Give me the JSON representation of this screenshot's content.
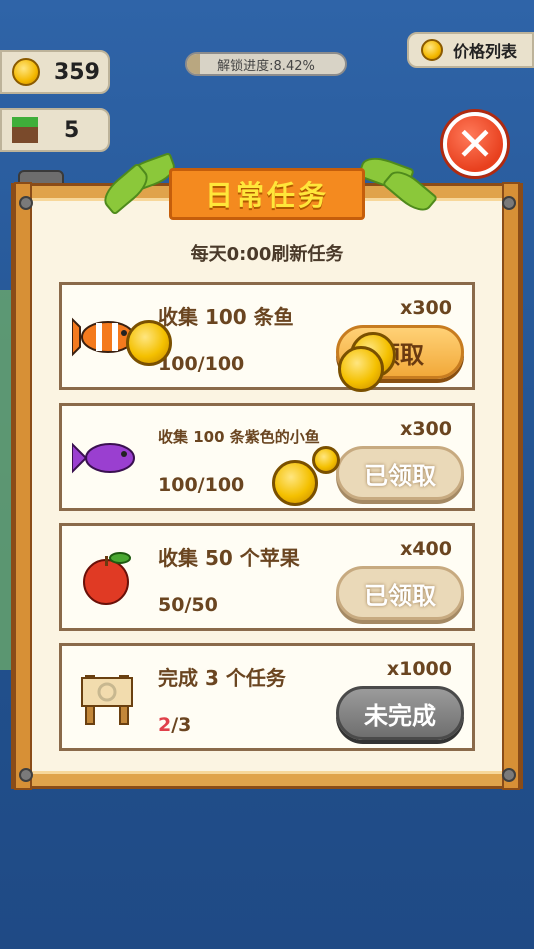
{
  "resources": {
    "coins": "359",
    "blocks": "5"
  },
  "unlock_progress": {
    "label": "解锁进度:8.42%",
    "percent": 8.42
  },
  "price_list": {
    "label": "价格列表"
  },
  "close": {
    "symbol": "✕"
  },
  "panel": {
    "title": "日常任务",
    "subtitle": "每天0:00刷新任务"
  },
  "tasks": [
    {
      "name": "收集 100 条鱼",
      "progress": "100/100",
      "reward": "x300",
      "button": "领取",
      "state": "claim",
      "icon": "clownfish-icon"
    },
    {
      "name": "收集 100 条紫色的小鱼",
      "progress": "100/100",
      "reward": "x300",
      "button": "已领取",
      "state": "claimed",
      "icon": "purple-fish-icon"
    },
    {
      "name": "收集 50 个苹果",
      "progress": "50/50",
      "reward": "x400",
      "button": "已领取",
      "state": "claimed",
      "icon": "apple-icon"
    },
    {
      "name": "完成 3 个任务",
      "progress_current": "2",
      "progress_total": "/3",
      "reward": "x1000",
      "button": "未完成",
      "state": "incomplete",
      "icon": "signboard-icon"
    }
  ],
  "colors": {
    "accent": "#f48a1f",
    "title_text": "#ffe63a",
    "frame": "#e0a34b",
    "task_text": "#6a4520"
  }
}
